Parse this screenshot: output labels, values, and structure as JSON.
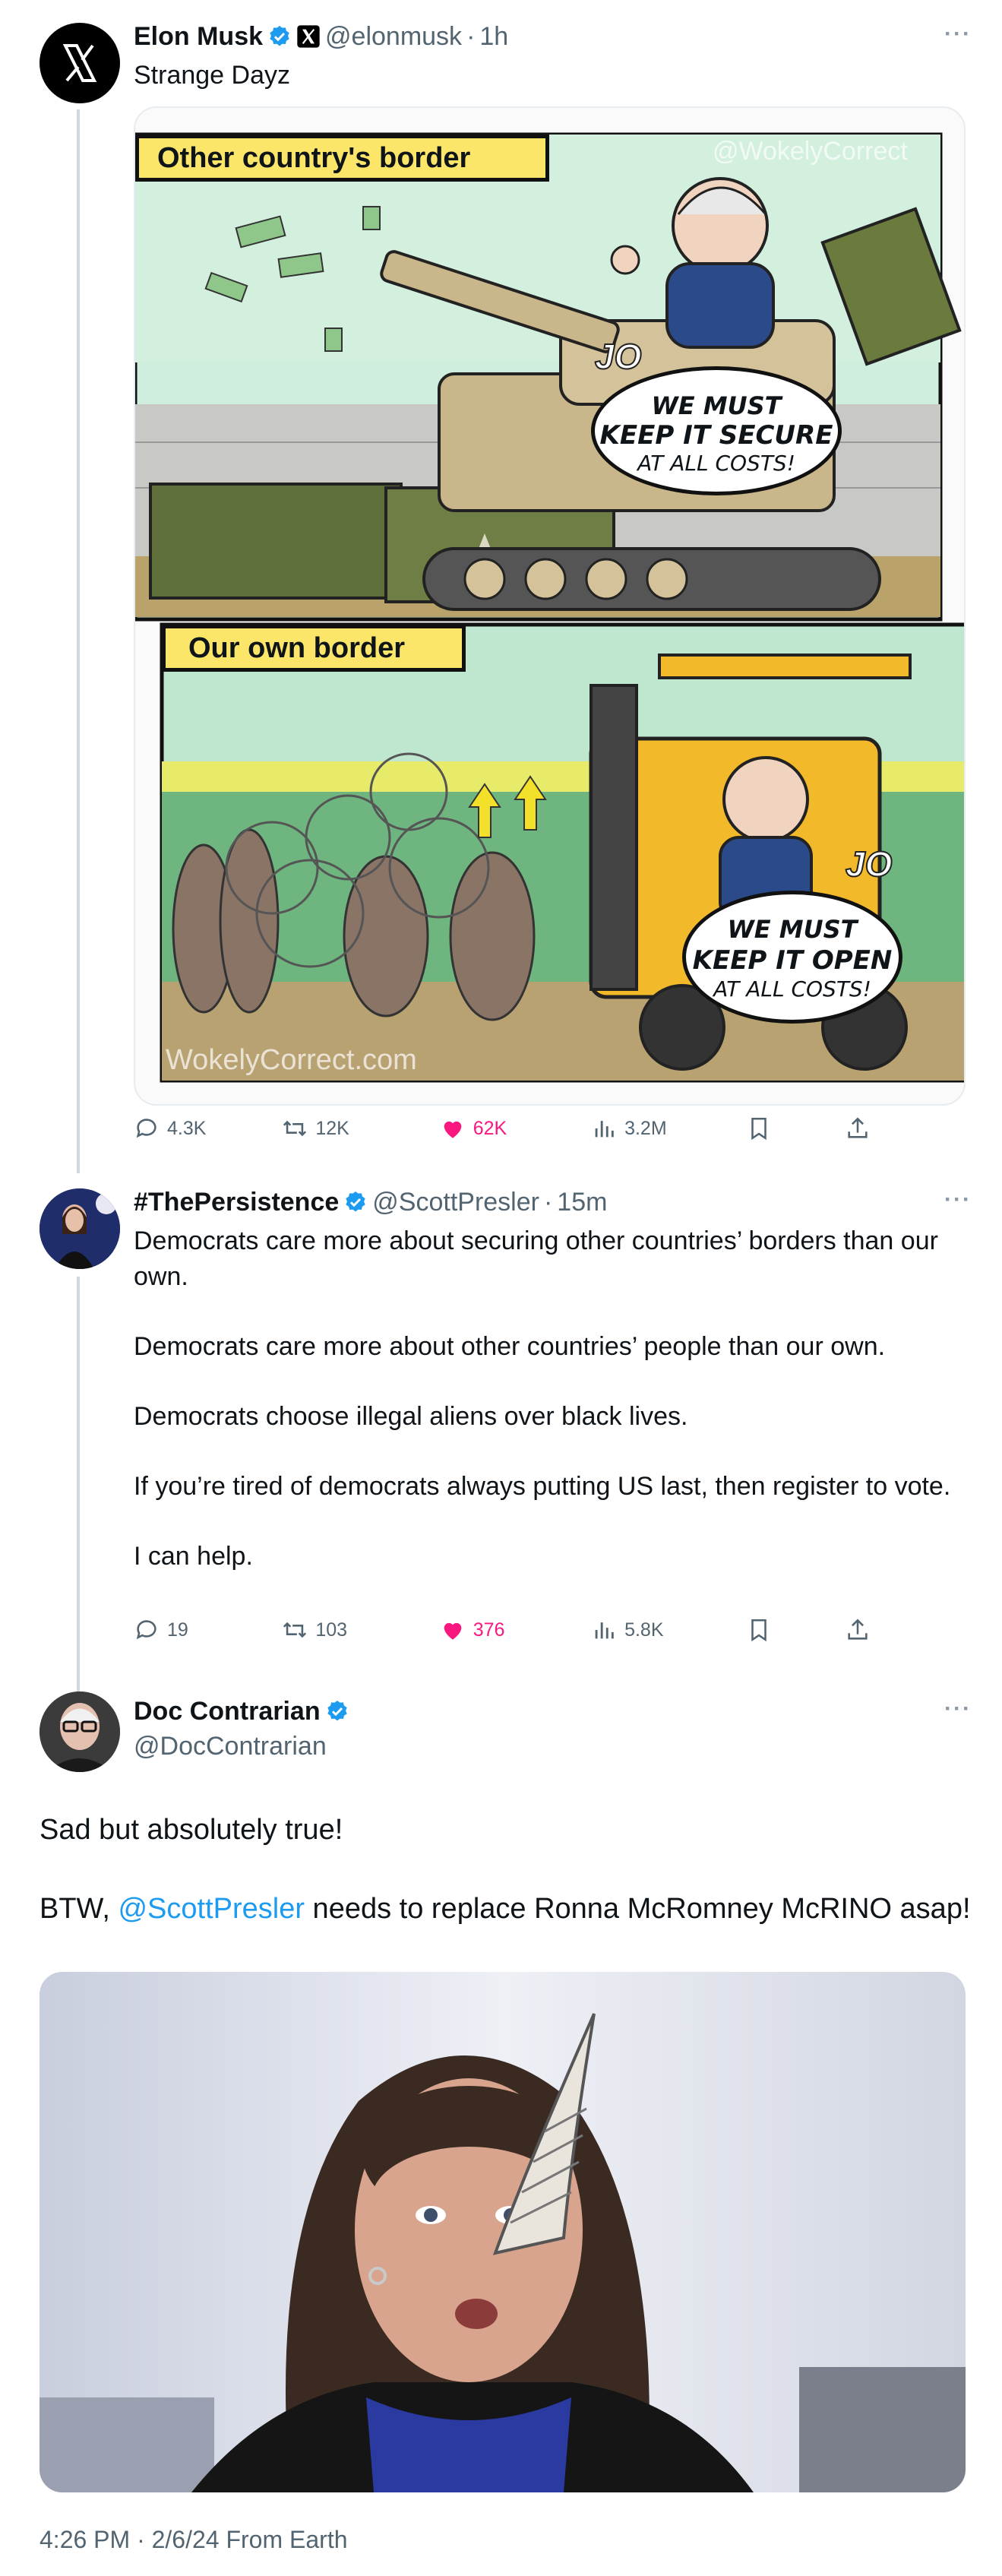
{
  "colors": {
    "accent": "#1d9bf0",
    "like": "#f91880",
    "muted": "#536471",
    "thread_line": "#cfd9de"
  },
  "tweet1": {
    "name": "Elon Musk",
    "handle": "@elonmusk",
    "separator": "·",
    "time": "1h",
    "text": "Strange Dayz",
    "comic": {
      "panel1_title": "Other country's border",
      "panel1_tank_label": "JO",
      "panel1_bubble_1": "WE MUST",
      "panel1_bubble_2": "KEEP IT SECURE",
      "panel1_bubble_3": "AT ALL COSTS!",
      "watermark_top": "@WokelyCorrect",
      "panel2_title": "Our own border",
      "panel2_forklift_label": "JO",
      "panel2_bubble_1": "WE MUST",
      "panel2_bubble_2": "KEEP IT OPEN",
      "panel2_bubble_3": "AT ALL COSTS!",
      "watermark_bottom": "WokelyCorrect.com"
    },
    "stats": {
      "replies": "4.3K",
      "reposts": "12K",
      "likes": "62K",
      "views": "3.2M"
    }
  },
  "tweet2": {
    "name": "#ThePersistence",
    "handle": "@ScottPresler",
    "separator": "·",
    "time": "15m",
    "paragraphs": [
      "Democrats care more about securing other countries’ borders than our own.",
      "Democrats care more about other countries’ people than our own.",
      "Democrats choose illegal aliens over black lives.",
      "If you’re tired of democrats always putting US last, then register to vote.",
      "I can help."
    ],
    "stats": {
      "replies": "19",
      "reposts": "103",
      "likes": "376",
      "views": "5.8K"
    }
  },
  "tweet3": {
    "name": "Doc Contrarian",
    "handle": "@DocContrarian",
    "line1": "Sad but absolutely true!",
    "line2_prefix": "BTW, ",
    "line2_mention": "@ScottPresler",
    "line2_suffix": " needs to replace Ronna McRomney McRINO asap!",
    "footer": "4:26 PM · 2/6/24 From Earth"
  },
  "icons": {
    "reply": "reply-icon",
    "repost": "repost-icon",
    "like": "heart-icon",
    "views": "views-icon",
    "bookmark": "bookmark-icon",
    "share": "share-icon",
    "verified": "verified-badge-icon",
    "more": "more-icon"
  }
}
